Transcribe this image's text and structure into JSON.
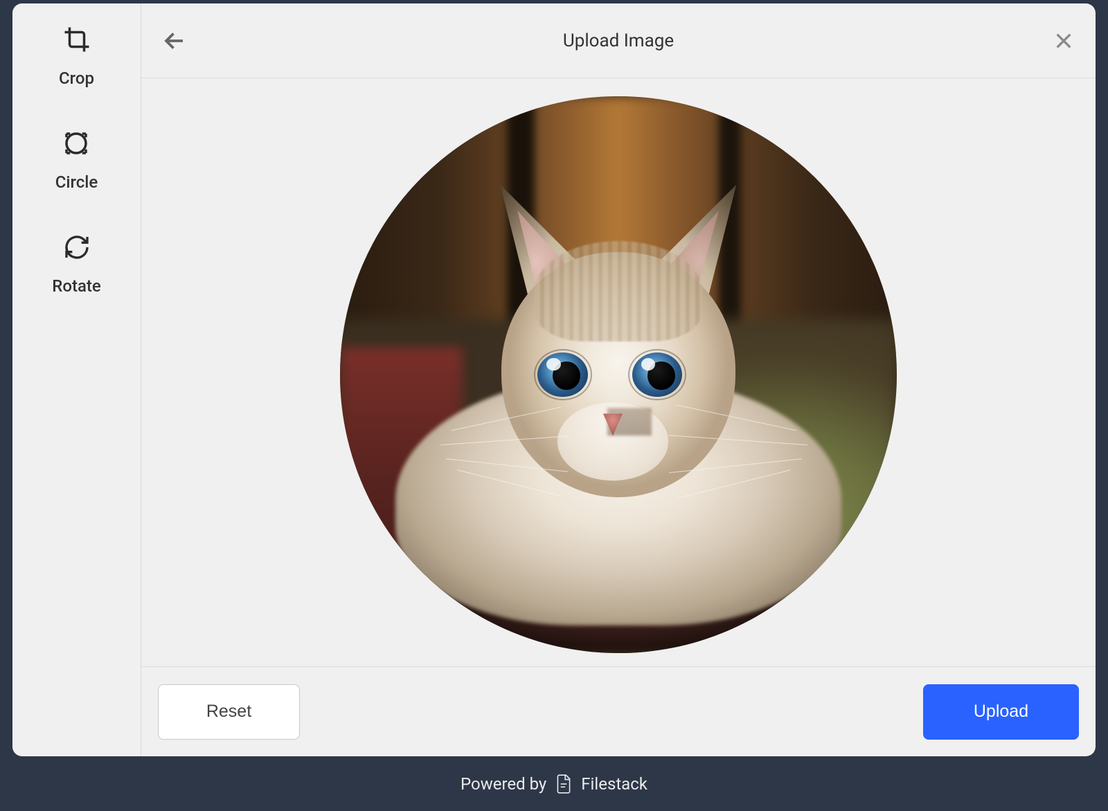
{
  "header": {
    "title": "Upload Image"
  },
  "sidebar": {
    "tools": [
      {
        "id": "crop",
        "label": "Crop",
        "icon": "crop-icon"
      },
      {
        "id": "circle",
        "label": "Circle",
        "icon": "circle-icon"
      },
      {
        "id": "rotate",
        "label": "Rotate",
        "icon": "rotate-icon"
      }
    ]
  },
  "actions": {
    "reset_label": "Reset",
    "upload_label": "Upload"
  },
  "footer": {
    "powered_by": "Powered by",
    "brand": "Filestack"
  },
  "colors": {
    "primary": "#2962ff",
    "modal_bg": "#f0f0f0",
    "page_bg": "#2d3748",
    "border": "#dcdcdc"
  },
  "preview": {
    "shape": "circle",
    "subject": "kitten"
  }
}
